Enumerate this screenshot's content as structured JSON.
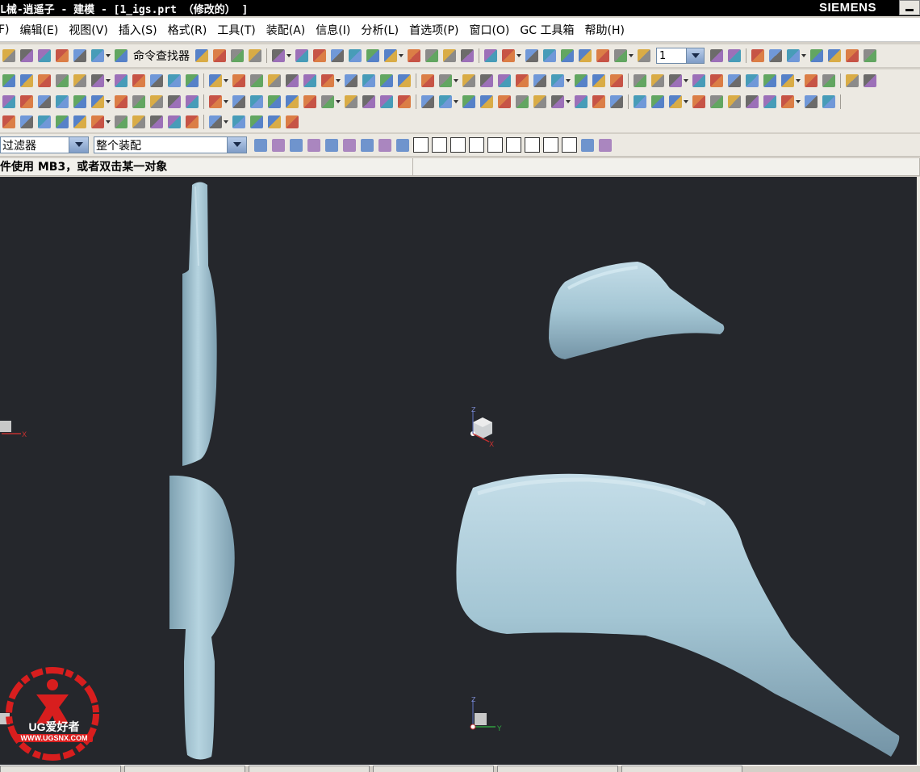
{
  "window": {
    "title": "L械-逍遥子 - 建模 - [1_igs.prt （修改的） ]",
    "brand": "SIEMENS"
  },
  "menu": [
    "F)",
    "编辑(E)",
    "视图(V)",
    "插入(S)",
    "格式(R)",
    "工具(T)",
    "装配(A)",
    "信息(I)",
    "分析(L)",
    "首选项(P)",
    "窗口(O)",
    "GC 工具箱",
    "帮助(H)"
  ],
  "toolbar": {
    "command_finder_label": "命令查找器",
    "layer_value": "1"
  },
  "selection": {
    "type_filter": "过滤器",
    "scope": "整个装配"
  },
  "cue_line": "件使用 MB3，或者双击某一对象",
  "viewport": {
    "background_color": "#25272c",
    "model_color": "#a4c6d4",
    "triad_labels": {
      "z": "Z",
      "x": "X",
      "y": "Y"
    }
  },
  "watermark": {
    "name": "UG爱好者",
    "url": "WWW.UGSNX.COM",
    "color": "#d81e1e"
  }
}
